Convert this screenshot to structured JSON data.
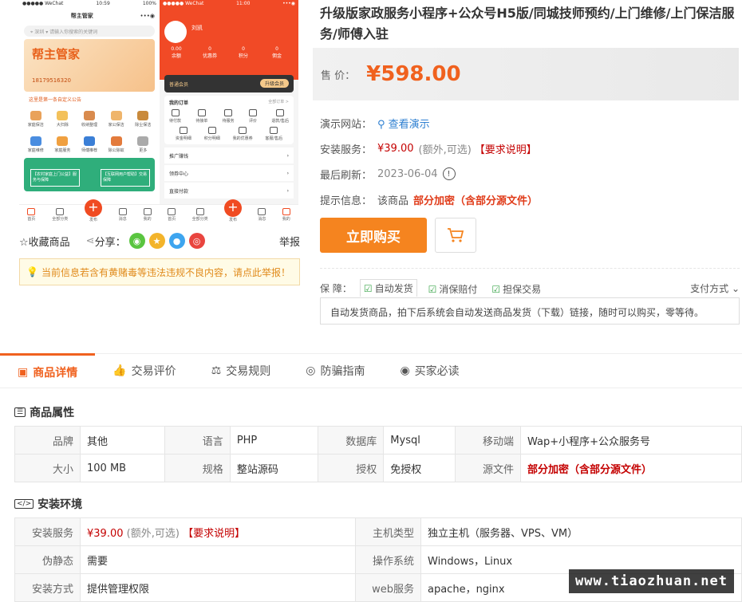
{
  "product": {
    "title": "升级版家政服务小程序+公众号H5版/同城技师预约/上门维修/上门保洁服务/师傅入驻",
    "price_label": "售 价：",
    "price": "¥598.00",
    "demo_label": "演示网站：",
    "demo_link": "查看演示",
    "install_label": "安装服务：",
    "install_price": "¥39.00",
    "install_extra": "(额外,可选)",
    "install_req": "【要求说明】",
    "refresh_label": "最后刷新：",
    "refresh_date": "2023-06-04",
    "tip_label": "提示信息：",
    "tip_text": "该商品",
    "tip_emph": "部分加密（含部分源文件）",
    "buy_button": "立即购买"
  },
  "guarantee": {
    "label": "保  障：",
    "tags": [
      "自动发货",
      "消保赔付",
      "担保交易"
    ],
    "pay_methods": "支付方式",
    "desc": "自动发货商品，拍下后系统会自动发送商品发货（下载）链接，随时可以购买，零等待。"
  },
  "left_actions": {
    "favorite": "收藏商品",
    "share": "分享：",
    "report": "举报",
    "warning": "当前信息若含有黄赌毒等违法违规不良内容，请点此举报！"
  },
  "screenshot": {
    "left_phone": {
      "status_left": "●●●●● WeChat",
      "time": "10:59",
      "battery": "100%",
      "title": "帮主管家",
      "search_city": "深圳",
      "search_placeholder": "请输入你搜索的关键词",
      "banner_title": "帮主管家",
      "banner_phone": "18179516320",
      "notice": "这里是第一条自定义公告",
      "grid": [
        "家庭保洁",
        "大扫除",
        "收纳整理",
        "家公保洁",
        "除尘保洁",
        "家庭维修",
        "家庭服务",
        "师傅推荐",
        "除公除蚁",
        "更多"
      ],
      "green_left": "【农村家庭上门公益】服务与保障",
      "green_right": "【互联网用户帮助】交易保障",
      "tabs": [
        "首页",
        "全部分类",
        "发布",
        "消息",
        "我的"
      ]
    },
    "right_phone": {
      "status_left": "●●●●● WeChat",
      "time": "11:00",
      "user_name": "刘凯",
      "stats": [
        {
          "n": "0.00",
          "l": "余额"
        },
        {
          "n": "0",
          "l": "优惠券"
        },
        {
          "n": "0",
          "l": "积分"
        },
        {
          "n": "0",
          "l": "佣金"
        }
      ],
      "vip": "普通会员",
      "vip_button": "升级会员",
      "orders_title": "我的订单",
      "orders_all": "全部订单 >",
      "orders": [
        "待付款",
        "待接单",
        "待服务",
        "评价",
        "退款/售后"
      ],
      "tools": [
        "资金明细",
        "积分明细",
        "我的优惠券",
        "客服/售后"
      ],
      "list": [
        "推广赚钱",
        "领券中心",
        "直接付款"
      ],
      "tabs": [
        "首页",
        "全部分类",
        "发布",
        "消息",
        "我的"
      ]
    }
  },
  "detail_tabs": [
    "商品详情",
    "交易评价",
    "交易规则",
    "防骗指南",
    "买家必读"
  ],
  "attributes": {
    "title": "商品属性",
    "rows": [
      [
        {
          "k": "品牌",
          "v": "其他"
        },
        {
          "k": "语言",
          "v": "PHP"
        },
        {
          "k": "数据库",
          "v": "Mysql"
        },
        {
          "k": "移动端",
          "v": "Wap+小程序+公众服务号"
        }
      ],
      [
        {
          "k": "大小",
          "v": "100 MB"
        },
        {
          "k": "规格",
          "v": "整站源码"
        },
        {
          "k": "授权",
          "v": "免授权"
        },
        {
          "k": "源文件",
          "v": "部分加密（含部分源文件）"
        }
      ]
    ]
  },
  "install_env": {
    "title": "安装环境",
    "rows": [
      [
        {
          "k": "安装服务",
          "v": "¥39.00",
          "extra": "(额外,可选)",
          "req": "【要求说明】"
        },
        {
          "k": "主机类型",
          "v": "独立主机（服务器、VPS、VM）"
        }
      ],
      [
        {
          "k": "伪静态",
          "v": "需要"
        },
        {
          "k": "操作系统",
          "v": "Windows，Linux"
        }
      ],
      [
        {
          "k": "安装方式",
          "v": "提供管理权限"
        },
        {
          "k": "web服务",
          "v": "apache，nginx"
        }
      ]
    ]
  },
  "watermark": "www.tiaozhuan.net",
  "colors": {
    "accent": "#f0611e",
    "buy": "#f5841f",
    "red": "#c40000",
    "green": "#3aa54a"
  }
}
